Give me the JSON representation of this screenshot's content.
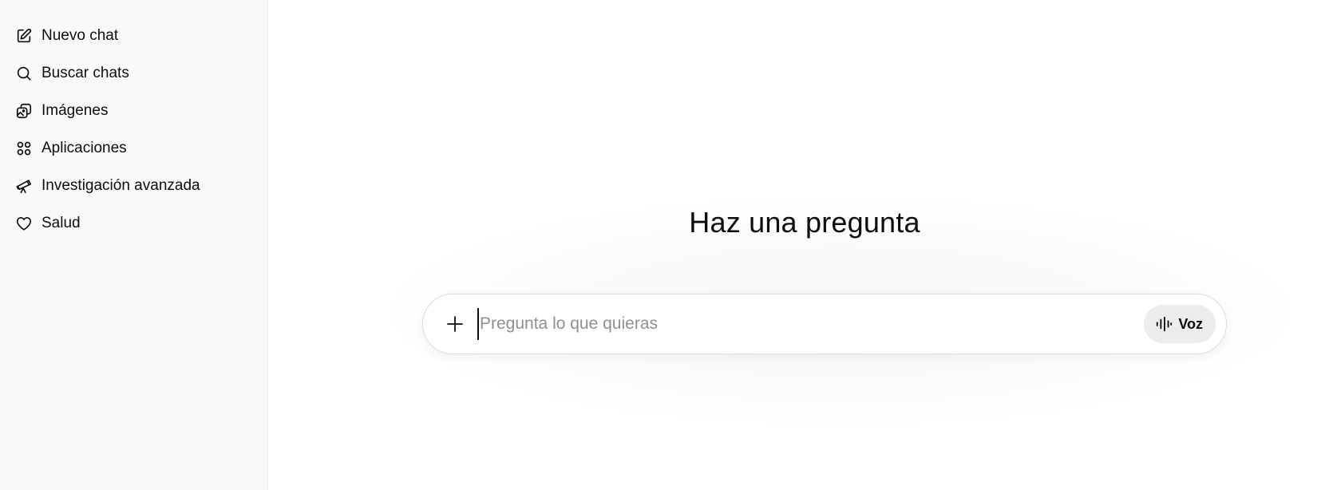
{
  "sidebar": {
    "items": [
      {
        "label": "Nuevo chat",
        "icon": "edit-icon"
      },
      {
        "label": "Buscar chats",
        "icon": "search-icon"
      },
      {
        "label": "Imágenes",
        "icon": "images-icon"
      },
      {
        "label": "Aplicaciones",
        "icon": "apps-grid-icon"
      },
      {
        "label": "Investigación avanzada",
        "icon": "telescope-icon"
      },
      {
        "label": "Salud",
        "icon": "heart-icon"
      }
    ]
  },
  "main": {
    "headline": "Haz una pregunta",
    "composer": {
      "placeholder": "Pregunta lo que quieras",
      "value": "",
      "add_icon": "plus-icon",
      "voice_icon": "voice-waveform-icon",
      "voice_label": "Voz"
    }
  },
  "colors": {
    "sidebar_bg": "#f9f9f9",
    "text": "#0d0d0d",
    "placeholder": "#8f8f8f",
    "voice_button_bg": "#ececec"
  }
}
